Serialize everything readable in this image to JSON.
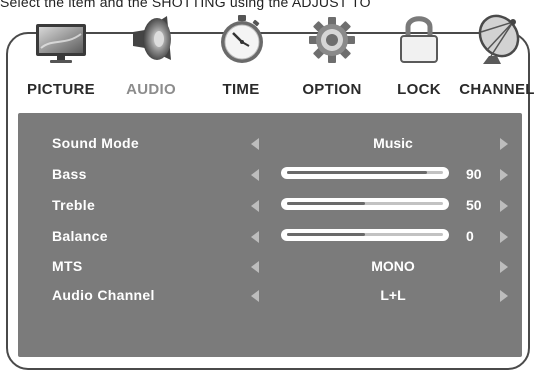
{
  "caption_text": "Select the item and the SHOTTING using the ADJUST TO",
  "tabs": [
    {
      "label": "PICTURE",
      "icon": "picture-tv-icon",
      "active": false
    },
    {
      "label": "AUDIO",
      "icon": "speaker-icon",
      "active": true
    },
    {
      "label": "TIME",
      "icon": "stopwatch-icon",
      "active": false
    },
    {
      "label": "OPTION",
      "icon": "gear-icon",
      "active": false
    },
    {
      "label": "LOCK",
      "icon": "padlock-icon",
      "active": false
    },
    {
      "label": "CHANNEL",
      "icon": "satellite-dish-icon",
      "active": false
    }
  ],
  "audio_menu": {
    "sound_mode": {
      "label": "Sound Mode",
      "value": "Music"
    },
    "bass": {
      "label": "Bass",
      "value": "90",
      "level": 0.9
    },
    "treble": {
      "label": "Treble",
      "value": "50",
      "level": 0.5
    },
    "balance": {
      "label": "Balance",
      "value": "0",
      "level": 0.5
    },
    "mts": {
      "label": "MTS",
      "value": "MONO"
    },
    "audio_channel": {
      "label": "Audio Channel",
      "value": "L+L"
    }
  },
  "colors": {
    "panel_background": "#7b7b7b",
    "active_tab_label": "#8c8c8c",
    "inactive_tab_label": "#2a2a2a",
    "menu_text": "#ffffff",
    "arrow": "#bdbdbd"
  }
}
